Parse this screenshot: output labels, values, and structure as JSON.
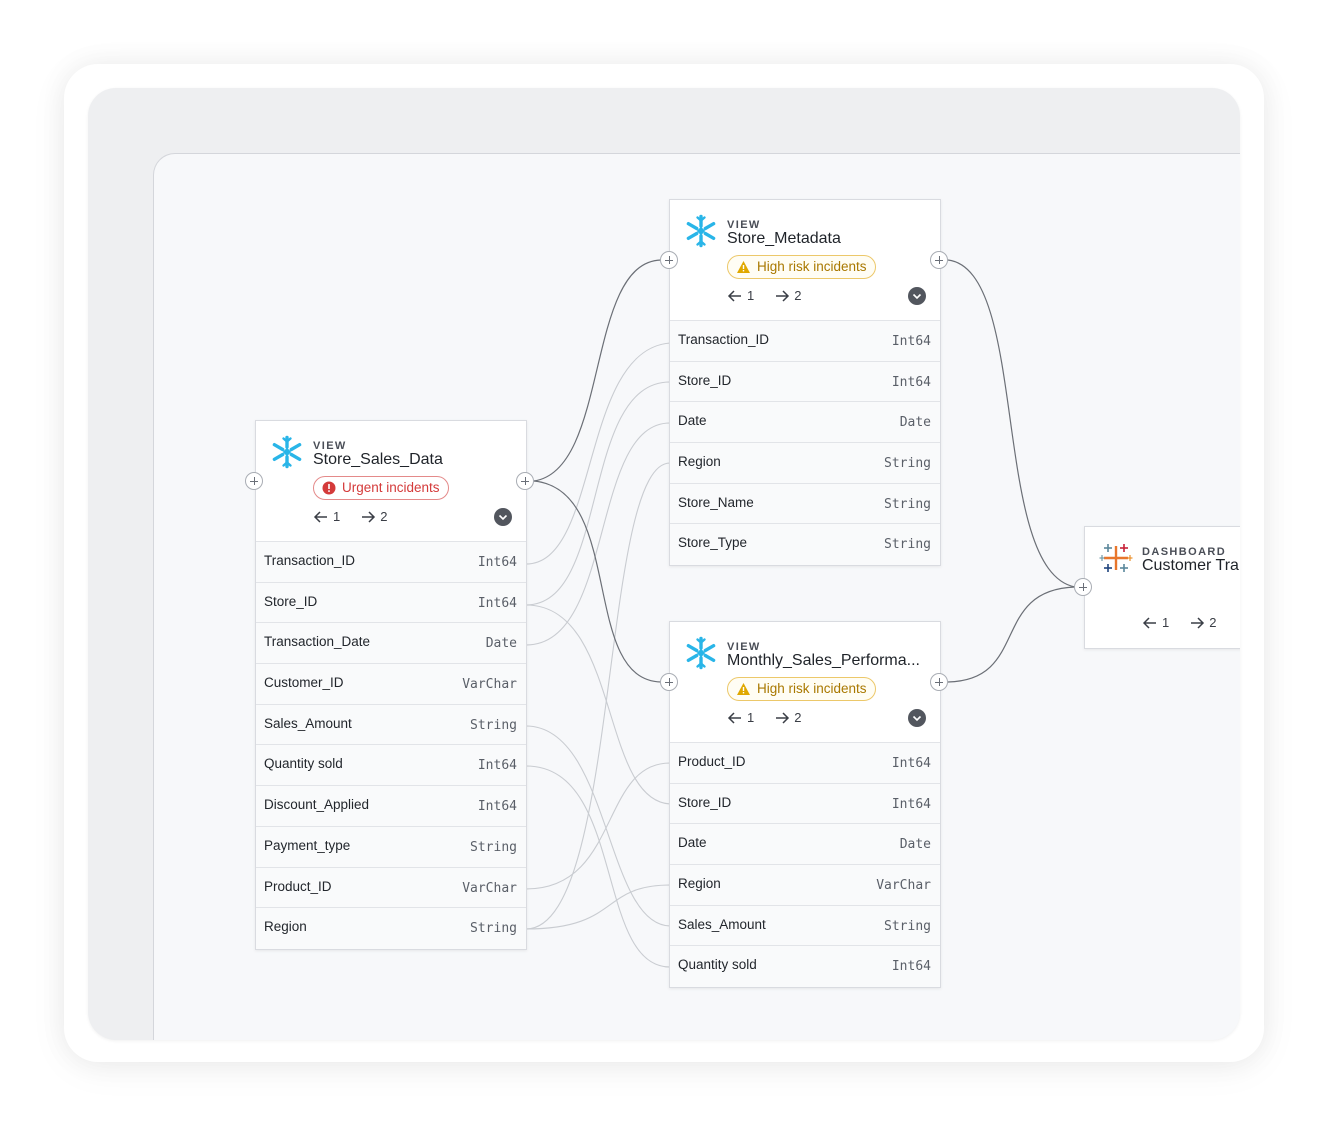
{
  "nodes": {
    "store_sales": {
      "kind": "VIEW",
      "title": "Store_Sales_Data",
      "badge": "Urgent incidents",
      "upstream": "1",
      "downstream": "2",
      "columns": [
        {
          "name": "Transaction_ID",
          "type": "Int64"
        },
        {
          "name": "Store_ID",
          "type": "Int64"
        },
        {
          "name": "Transaction_Date",
          "type": "Date"
        },
        {
          "name": "Customer_ID",
          "type": "VarChar"
        },
        {
          "name": "Sales_Amount",
          "type": "String"
        },
        {
          "name": "Quantity sold",
          "type": "Int64"
        },
        {
          "name": "Discount_Applied",
          "type": "Int64"
        },
        {
          "name": "Payment_type",
          "type": "String"
        },
        {
          "name": "Product_ID",
          "type": "VarChar"
        },
        {
          "name": "Region",
          "type": "String"
        }
      ]
    },
    "store_metadata": {
      "kind": "VIEW",
      "title": "Store_Metadata",
      "badge": "High risk incidents",
      "upstream": "1",
      "downstream": "2",
      "columns": [
        {
          "name": "Transaction_ID",
          "type": "Int64"
        },
        {
          "name": "Store_ID",
          "type": "Int64"
        },
        {
          "name": "Date",
          "type": "Date"
        },
        {
          "name": "Region",
          "type": "String"
        },
        {
          "name": "Store_Name",
          "type": "String"
        },
        {
          "name": "Store_Type",
          "type": "String"
        }
      ]
    },
    "monthly_sales": {
      "kind": "VIEW",
      "title": "Monthly_Sales_Performa...",
      "badge": "High risk incidents",
      "upstream": "1",
      "downstream": "2",
      "columns": [
        {
          "name": "Product_ID",
          "type": "Int64"
        },
        {
          "name": "Store_ID",
          "type": "Int64"
        },
        {
          "name": "Date",
          "type": "Date"
        },
        {
          "name": "Region",
          "type": "VarChar"
        },
        {
          "name": "Sales_Amount",
          "type": "String"
        },
        {
          "name": "Quantity sold",
          "type": "Int64"
        }
      ]
    },
    "dashboard": {
      "kind": "DASHBOARD",
      "title": "Customer Tra",
      "upstream": "1",
      "downstream": "2"
    }
  },
  "colors": {
    "snowflake": "#29b5e8",
    "urgent": "#d43a3a",
    "risk": "#a97800",
    "edge_main": "#6b6f76",
    "edge_column": "#c9ccd1"
  },
  "icons": [
    "snowflake-icon",
    "tableau-icon",
    "warning-icon",
    "alert-icon",
    "arrow-left-icon",
    "arrow-right-icon",
    "chevron-down-icon",
    "plus-icon"
  ]
}
